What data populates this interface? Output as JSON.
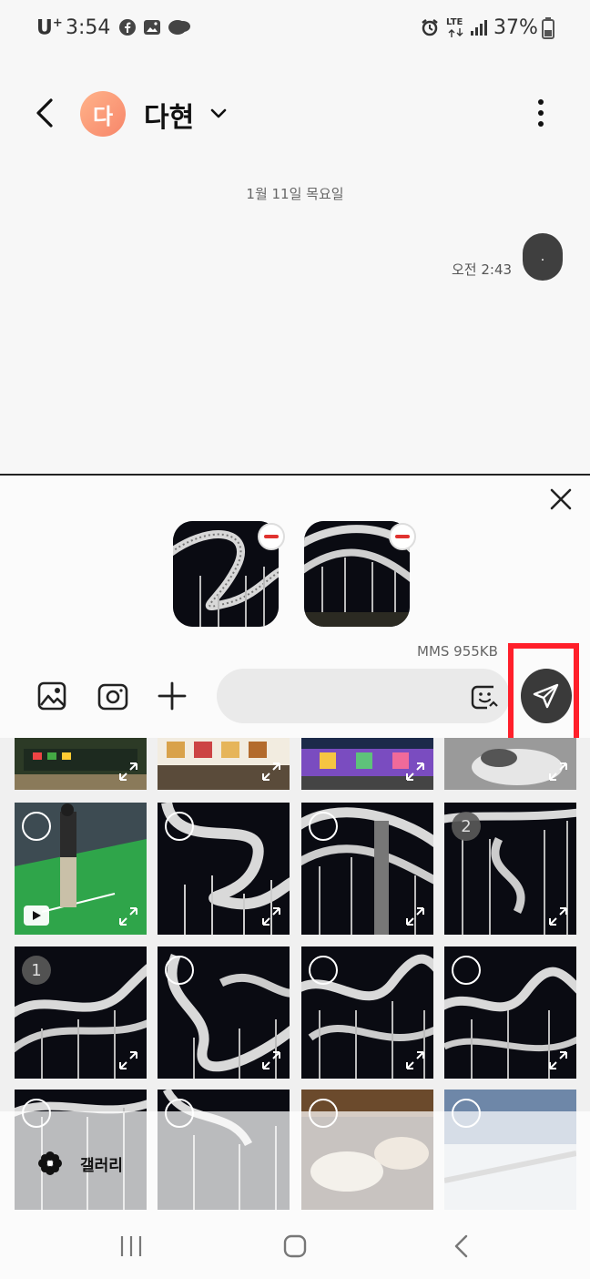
{
  "status_bar": {
    "carrier": "U",
    "carrier_sup": "+",
    "time": "3:54",
    "network": "LTE",
    "battery": "37%"
  },
  "header": {
    "avatar_initial": "다",
    "contact_name": "다현"
  },
  "conversation": {
    "date_separator": "1월 11일 목요일",
    "message_time": "오전 2:43",
    "message_text": "."
  },
  "attachment_panel": {
    "size_label": "MMS 955KB",
    "selected_count": 2
  },
  "gallery": {
    "label": "갤러리",
    "numbered_selections": [
      "1",
      "2"
    ]
  },
  "colors": {
    "send_button": "#3a3a3a",
    "highlight_box": "#ff1f2a",
    "remove_badge": "#e0322f"
  },
  "icons": [
    "back-icon",
    "chevron-down-icon",
    "more-vert-icon",
    "close-icon",
    "image-icon",
    "camera-icon",
    "plus-icon",
    "emoji-icon",
    "send-icon",
    "expand-icon",
    "play-icon",
    "flower-icon",
    "recents-icon",
    "home-icon",
    "nav-back-icon"
  ]
}
